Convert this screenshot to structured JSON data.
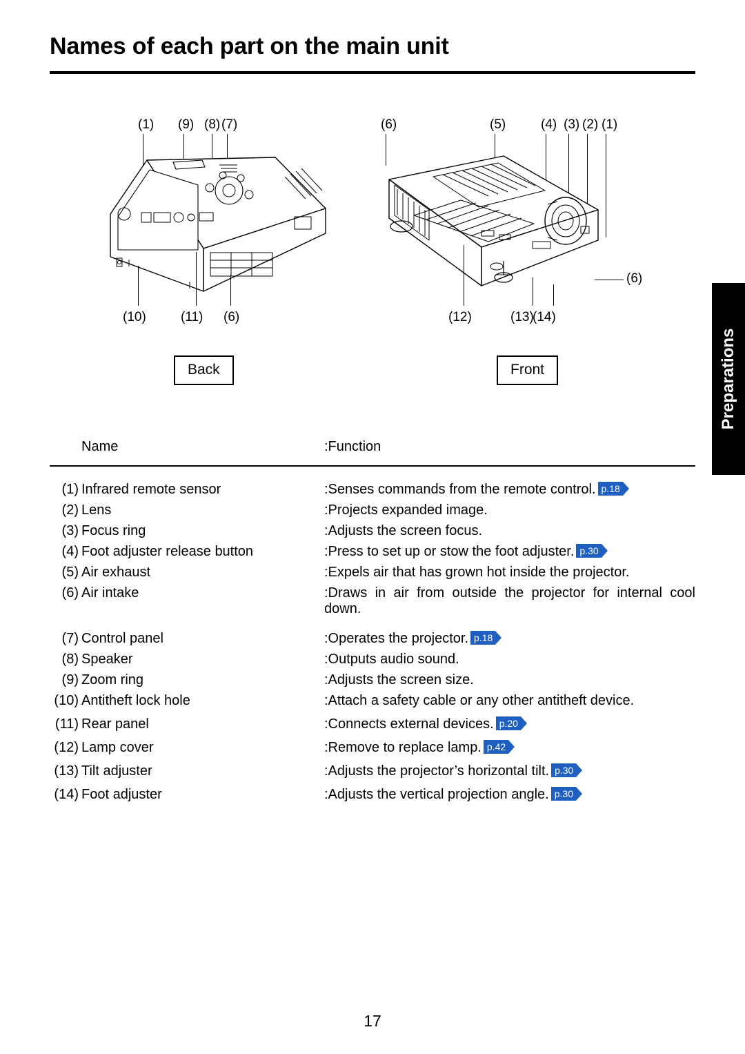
{
  "page": {
    "title": "Names of each part on the main unit",
    "folio": "17",
    "side_tab": "Preparations"
  },
  "figures": {
    "back": {
      "label": "Back",
      "top_callouts": [
        "(1)",
        "(9)",
        "(8)",
        "(7)"
      ],
      "bottom_callouts": [
        "(10)",
        "(11)",
        "(6)"
      ]
    },
    "front": {
      "label": "Front",
      "top_callouts": [
        "(6)",
        "(5)",
        "(4)",
        "(3)",
        "(2)",
        "(1)"
      ],
      "bottom_callouts": [
        "(12)",
        "(13)",
        "(14)"
      ],
      "right_callout": "(6)"
    }
  },
  "table": {
    "headers": {
      "name": "Name",
      "function": ":Function"
    },
    "rows": [
      {
        "num": "1",
        "name": "Infrared remote sensor",
        "function": ":Senses commands from the remote control.",
        "pageref": "p.18"
      },
      {
        "num": "2",
        "name": "Lens",
        "function": ":Projects expanded image.",
        "pageref": ""
      },
      {
        "num": "3",
        "name": "Focus ring",
        "function": ":Adjusts the screen focus.",
        "pageref": ""
      },
      {
        "num": "4",
        "name": "Foot adjuster release button",
        "function": ":Press to set up or stow the foot adjuster.",
        "pageref": "p.30"
      },
      {
        "num": "5",
        "name": "Air exhaust",
        "function": ":Expels air that has grown hot inside the projector.",
        "pageref": ""
      },
      {
        "num": "6",
        "name": "Air intake",
        "function": ":Draws in air from outside the projector for internal cool down.",
        "pageref": ""
      },
      {
        "num": "7",
        "name": "Control panel",
        "function": ":Operates the projector.",
        "pageref": "p.18"
      },
      {
        "num": "8",
        "name": "Speaker",
        "function": ":Outputs audio sound.",
        "pageref": ""
      },
      {
        "num": "9",
        "name": "Zoom ring",
        "function": ":Adjusts the screen size.",
        "pageref": ""
      },
      {
        "num": "10",
        "name": "Antitheft lock hole",
        "function": ":Attach a safety cable or any other antitheft device.",
        "pageref": ""
      },
      {
        "num": "11",
        "name": "Rear panel",
        "function": ":Connects external devices.",
        "pageref": "p.20"
      },
      {
        "num": "12",
        "name": "Lamp cover",
        "function": ":Remove to replace lamp.",
        "pageref": "p.42"
      },
      {
        "num": "13",
        "name": "Tilt adjuster",
        "function": ":Adjusts the projector’s horizontal tilt.",
        "pageref": "p.30"
      },
      {
        "num": "14",
        "name": "Foot adjuster",
        "function": ":Adjusts the vertical projection angle.",
        "pageref": "p.30"
      }
    ]
  },
  "colors": {
    "pageref_bg": "#1f5fbf",
    "text": "#000000",
    "background": "#ffffff",
    "tab_bg": "#000000"
  }
}
